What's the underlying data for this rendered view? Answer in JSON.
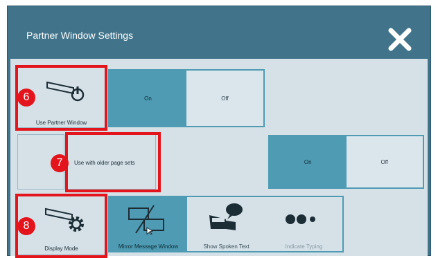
{
  "dialog": {
    "title": "Partner Window Settings",
    "close_icon": "close-x-icon"
  },
  "settings": {
    "use_partner_window": {
      "label": "Use Partner Window",
      "on_label": "On",
      "off_label": "Off",
      "selected": "On",
      "badge": "6"
    },
    "use_older_page_sets": {
      "label": "Use with older page sets",
      "on_label": "On",
      "off_label": "Off",
      "selected": "On",
      "badge": "7"
    },
    "display_mode": {
      "label": "Display Mode",
      "badge": "8",
      "options": [
        {
          "label": "Mirror Message Window",
          "icon": "mirror-window-icon",
          "selected": true
        },
        {
          "label": "Show Spoken Text",
          "icon": "speaker-person-icon",
          "selected": false
        },
        {
          "label": "Indicate Typing",
          "icon": "typing-dots-icon",
          "selected": false
        }
      ]
    }
  },
  "colors": {
    "header": "#41748a",
    "panel": "#d5e1e7",
    "selected": "#4e9bb3",
    "callout": "#e3141b"
  }
}
